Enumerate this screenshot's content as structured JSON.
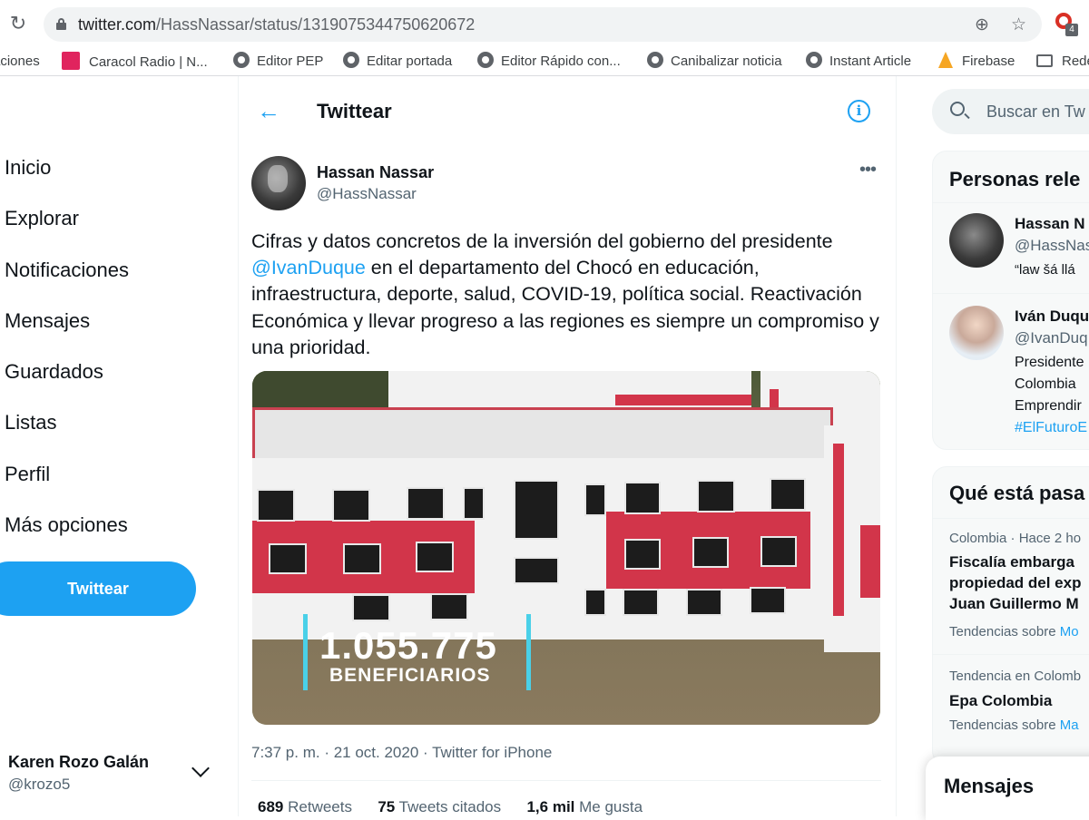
{
  "browser": {
    "url_host": "twitter.com",
    "url_path": "/HassNassar/status/1319075344750620672",
    "bookmarks": [
      {
        "label": "aciones",
        "icon": "none"
      },
      {
        "label": "Caracol Radio | N...",
        "icon": "caracol-icon"
      },
      {
        "label": "Editor PEP",
        "icon": "globe-icon"
      },
      {
        "label": "Editar portada",
        "icon": "globe-icon"
      },
      {
        "label": "Editor Rápido con...",
        "icon": "globe-icon"
      },
      {
        "label": "Canibalizar noticia",
        "icon": "globe-icon"
      },
      {
        "label": "Instant Article",
        "icon": "globe-icon"
      },
      {
        "label": "Firebase",
        "icon": "firebase-icon"
      },
      {
        "label": "Rede",
        "icon": "folder-icon"
      }
    ],
    "extension_badge": "4"
  },
  "nav": {
    "items": [
      {
        "label": "Inicio"
      },
      {
        "label": "Explorar"
      },
      {
        "label": "Notificaciones"
      },
      {
        "label": "Mensajes"
      },
      {
        "label": "Guardados"
      },
      {
        "label": "Listas"
      },
      {
        "label": "Perfil"
      },
      {
        "label": "Más opciones"
      }
    ],
    "tweet_button": "Twittear",
    "account": {
      "name": "Karen Rozo Galán",
      "handle": "@krozo5"
    }
  },
  "header": {
    "title": "Twittear"
  },
  "tweet": {
    "author_name": "Hassan Nassar",
    "author_handle": "@HassNassar",
    "text_before": "Cifras y datos concretos de la inversión del gobierno del presidente ",
    "mention": "@IvanDuque",
    "text_after": " en el departamento del Chocó en educación, infraestructura, deporte, salud, COVID-19, política social. Reactivación Económica y llevar progreso a las regiones es siempre un compromiso y una prioridad.",
    "media_overlay": {
      "number": "1.055.775",
      "label": "BENEFICIARIOS"
    },
    "meta": "7:37 p. m. · 21 oct. 2020 · Twitter for iPhone",
    "stats": {
      "retweets_count": "689",
      "retweets_label": "Retweets",
      "quotes_count": "75",
      "quotes_label": "Tweets citados",
      "likes_count": "1,6 mil",
      "likes_label": "Me gusta"
    }
  },
  "sidebar": {
    "search_placeholder": "Buscar en Tw",
    "people_title": "Personas rele",
    "people": [
      {
        "name": "Hassan N",
        "handle": "@HassNas",
        "bio": "“law šá llá"
      },
      {
        "name": "Iván Duqu",
        "handle": "@IvanDuq",
        "bio_lines": [
          "Presidente",
          "Colombia",
          "Emprendir",
          "#ElFuturoE"
        ]
      }
    ],
    "trends_title": "Qué está pasa",
    "trends": [
      {
        "meta": "Colombia · Hace 2 ho",
        "title_lines": [
          "Fiscalía embarga",
          "propiedad del exp",
          "Juan Guillermo M"
        ],
        "footer": "Tendencias sobre ",
        "footer_link": "Mo"
      },
      {
        "meta": "Tendencia en Colomb",
        "title_lines": [
          "Epa Colombia"
        ],
        "footer": "Tendencias sobre ",
        "footer_link": "Ma"
      }
    ],
    "messages_title": "Mensajes"
  },
  "colors": {
    "accent": "#1da1f2",
    "text": "#0f1419",
    "muted": "#536471"
  }
}
